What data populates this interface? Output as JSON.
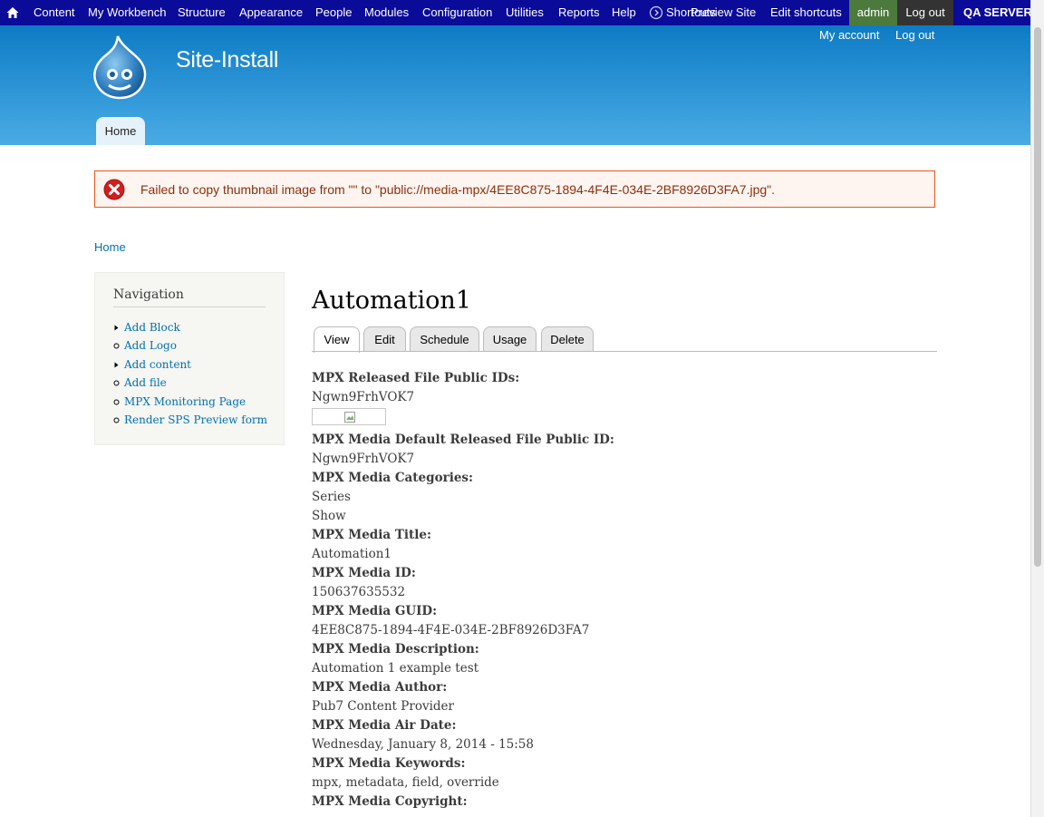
{
  "toolbar": {
    "items": [
      "Content",
      "My Workbench",
      "Structure",
      "Appearance",
      "People",
      "Modules",
      "Configuration",
      "Utilities",
      "Reports",
      "Help"
    ],
    "shortcuts_label": "Shortcuts",
    "preview_site": "Preview Site",
    "edit_shortcuts": "Edit shortcuts",
    "admin": "admin",
    "log_out": "Log out",
    "server": "QA SERVER",
    "colors": {
      "bar": "#0b0b9a",
      "admin": "#4c7a3c",
      "logout": "#333333"
    }
  },
  "header": {
    "site_name": "Site-Install",
    "secondary_links": [
      "My account",
      "Log out"
    ],
    "main_tab": "Home"
  },
  "message": {
    "type": "error",
    "text": "Failed to copy thumbnail image from \"\" to \"public://media-mpx/4EE8C875-1894-4F4E-034E-2BF8926D3FA7.jpg\"."
  },
  "breadcrumb": "Home",
  "sidebar": {
    "title": "Navigation",
    "items": [
      {
        "label": "Add Block",
        "bullet": "arrow"
      },
      {
        "label": "Add Logo",
        "bullet": "circle"
      },
      {
        "label": "Add content",
        "bullet": "arrow"
      },
      {
        "label": "Add file",
        "bullet": "circle"
      },
      {
        "label": "MPX Monitoring Page",
        "bullet": "circle"
      },
      {
        "label": "Render SPS Preview form",
        "bullet": "circle"
      }
    ]
  },
  "page": {
    "title": "Automation1",
    "tabs": [
      "View",
      "Edit",
      "Schedule",
      "Usage",
      "Delete"
    ],
    "active_tab": "View",
    "fields": [
      {
        "label": "MPX Released File Public IDs:",
        "values": [
          "Ngwn9FrhVOK7"
        ],
        "has_image": true
      },
      {
        "label": "MPX Media Default Released File Public ID:",
        "values": [
          "Ngwn9FrhVOK7"
        ]
      },
      {
        "label": "MPX Media Categories:",
        "values": [
          "Series",
          "Show"
        ]
      },
      {
        "label": "MPX Media Title:",
        "values": [
          "Automation1"
        ]
      },
      {
        "label": "MPX Media ID:",
        "values": [
          "150637635532"
        ]
      },
      {
        "label": "MPX Media GUID:",
        "values": [
          "4EE8C875-1894-4F4E-034E-2BF8926D3FA7"
        ]
      },
      {
        "label": "MPX Media Description:",
        "values": [
          "Automation 1 example test"
        ]
      },
      {
        "label": "MPX Media Author:",
        "values": [
          "Pub7 Content Provider"
        ]
      },
      {
        "label": "MPX Media Air Date:",
        "values": [
          "Wednesday, January 8, 2014 - 15:58"
        ]
      },
      {
        "label": "MPX Media Keywords:",
        "values": [
          "mpx, metadata, field, override"
        ]
      },
      {
        "label": "MPX Media Copyright:",
        "values": []
      }
    ]
  }
}
